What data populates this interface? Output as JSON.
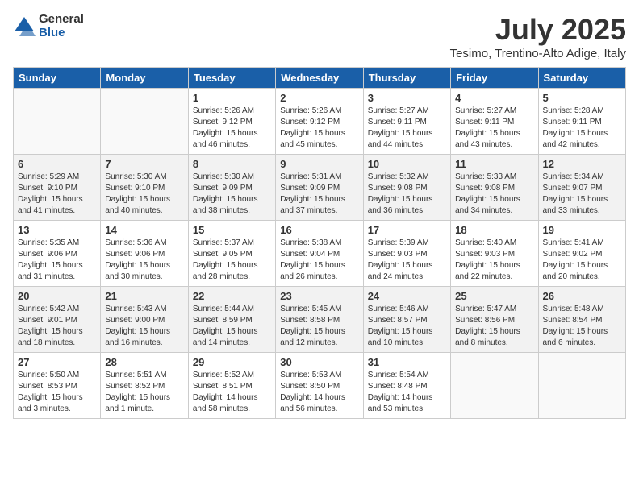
{
  "logo": {
    "general": "General",
    "blue": "Blue"
  },
  "title": "July 2025",
  "location": "Tesimo, Trentino-Alto Adige, Italy",
  "headers": [
    "Sunday",
    "Monday",
    "Tuesday",
    "Wednesday",
    "Thursday",
    "Friday",
    "Saturday"
  ],
  "weeks": [
    [
      {
        "day": "",
        "info": ""
      },
      {
        "day": "",
        "info": ""
      },
      {
        "day": "1",
        "info": "Sunrise: 5:26 AM\nSunset: 9:12 PM\nDaylight: 15 hours\nand 46 minutes."
      },
      {
        "day": "2",
        "info": "Sunrise: 5:26 AM\nSunset: 9:12 PM\nDaylight: 15 hours\nand 45 minutes."
      },
      {
        "day": "3",
        "info": "Sunrise: 5:27 AM\nSunset: 9:11 PM\nDaylight: 15 hours\nand 44 minutes."
      },
      {
        "day": "4",
        "info": "Sunrise: 5:27 AM\nSunset: 9:11 PM\nDaylight: 15 hours\nand 43 minutes."
      },
      {
        "day": "5",
        "info": "Sunrise: 5:28 AM\nSunset: 9:11 PM\nDaylight: 15 hours\nand 42 minutes."
      }
    ],
    [
      {
        "day": "6",
        "info": "Sunrise: 5:29 AM\nSunset: 9:10 PM\nDaylight: 15 hours\nand 41 minutes."
      },
      {
        "day": "7",
        "info": "Sunrise: 5:30 AM\nSunset: 9:10 PM\nDaylight: 15 hours\nand 40 minutes."
      },
      {
        "day": "8",
        "info": "Sunrise: 5:30 AM\nSunset: 9:09 PM\nDaylight: 15 hours\nand 38 minutes."
      },
      {
        "day": "9",
        "info": "Sunrise: 5:31 AM\nSunset: 9:09 PM\nDaylight: 15 hours\nand 37 minutes."
      },
      {
        "day": "10",
        "info": "Sunrise: 5:32 AM\nSunset: 9:08 PM\nDaylight: 15 hours\nand 36 minutes."
      },
      {
        "day": "11",
        "info": "Sunrise: 5:33 AM\nSunset: 9:08 PM\nDaylight: 15 hours\nand 34 minutes."
      },
      {
        "day": "12",
        "info": "Sunrise: 5:34 AM\nSunset: 9:07 PM\nDaylight: 15 hours\nand 33 minutes."
      }
    ],
    [
      {
        "day": "13",
        "info": "Sunrise: 5:35 AM\nSunset: 9:06 PM\nDaylight: 15 hours\nand 31 minutes."
      },
      {
        "day": "14",
        "info": "Sunrise: 5:36 AM\nSunset: 9:06 PM\nDaylight: 15 hours\nand 30 minutes."
      },
      {
        "day": "15",
        "info": "Sunrise: 5:37 AM\nSunset: 9:05 PM\nDaylight: 15 hours\nand 28 minutes."
      },
      {
        "day": "16",
        "info": "Sunrise: 5:38 AM\nSunset: 9:04 PM\nDaylight: 15 hours\nand 26 minutes."
      },
      {
        "day": "17",
        "info": "Sunrise: 5:39 AM\nSunset: 9:03 PM\nDaylight: 15 hours\nand 24 minutes."
      },
      {
        "day": "18",
        "info": "Sunrise: 5:40 AM\nSunset: 9:03 PM\nDaylight: 15 hours\nand 22 minutes."
      },
      {
        "day": "19",
        "info": "Sunrise: 5:41 AM\nSunset: 9:02 PM\nDaylight: 15 hours\nand 20 minutes."
      }
    ],
    [
      {
        "day": "20",
        "info": "Sunrise: 5:42 AM\nSunset: 9:01 PM\nDaylight: 15 hours\nand 18 minutes."
      },
      {
        "day": "21",
        "info": "Sunrise: 5:43 AM\nSunset: 9:00 PM\nDaylight: 15 hours\nand 16 minutes."
      },
      {
        "day": "22",
        "info": "Sunrise: 5:44 AM\nSunset: 8:59 PM\nDaylight: 15 hours\nand 14 minutes."
      },
      {
        "day": "23",
        "info": "Sunrise: 5:45 AM\nSunset: 8:58 PM\nDaylight: 15 hours\nand 12 minutes."
      },
      {
        "day": "24",
        "info": "Sunrise: 5:46 AM\nSunset: 8:57 PM\nDaylight: 15 hours\nand 10 minutes."
      },
      {
        "day": "25",
        "info": "Sunrise: 5:47 AM\nSunset: 8:56 PM\nDaylight: 15 hours\nand 8 minutes."
      },
      {
        "day": "26",
        "info": "Sunrise: 5:48 AM\nSunset: 8:54 PM\nDaylight: 15 hours\nand 6 minutes."
      }
    ],
    [
      {
        "day": "27",
        "info": "Sunrise: 5:50 AM\nSunset: 8:53 PM\nDaylight: 15 hours\nand 3 minutes."
      },
      {
        "day": "28",
        "info": "Sunrise: 5:51 AM\nSunset: 8:52 PM\nDaylight: 15 hours\nand 1 minute."
      },
      {
        "day": "29",
        "info": "Sunrise: 5:52 AM\nSunset: 8:51 PM\nDaylight: 14 hours\nand 58 minutes."
      },
      {
        "day": "30",
        "info": "Sunrise: 5:53 AM\nSunset: 8:50 PM\nDaylight: 14 hours\nand 56 minutes."
      },
      {
        "day": "31",
        "info": "Sunrise: 5:54 AM\nSunset: 8:48 PM\nDaylight: 14 hours\nand 53 minutes."
      },
      {
        "day": "",
        "info": ""
      },
      {
        "day": "",
        "info": ""
      }
    ]
  ]
}
